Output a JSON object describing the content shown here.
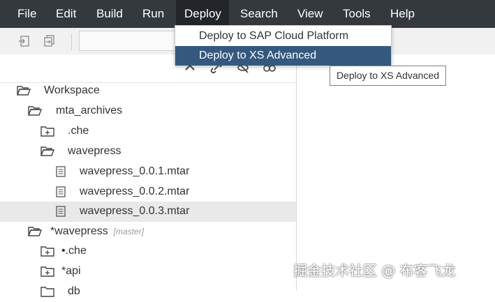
{
  "menubar": {
    "items": [
      "File",
      "Edit",
      "Build",
      "Run",
      "Deploy",
      "Search",
      "View",
      "Tools",
      "Help"
    ],
    "active": "Deploy"
  },
  "deploy_menu": {
    "items": [
      "Deploy to SAP Cloud Platform",
      "Deploy to XS Advanced"
    ],
    "highlighted": "Deploy to XS Advanced"
  },
  "tooltip": {
    "text": "Deploy to XS Advanced"
  },
  "tree": {
    "workspace": "Workspace",
    "mta_archives": "mta_archives",
    "che1": ".che",
    "wavepress_folder": "wavepress",
    "file1": "wavepress_0.0.1.mtar",
    "file2": "wavepress_0.0.2.mtar",
    "file3": "wavepress_0.0.3.mtar",
    "project_star": "*",
    "project": "wavepress",
    "project_branch": "[master]",
    "che2": "•.che",
    "api_star": "*",
    "api": "api",
    "db": "db"
  },
  "watermark": "掘金技术社区 @ 布客飞龙",
  "colors": {
    "menubar_bg": "#34393e",
    "menu_highlight": "#35597e",
    "selected_row": "#e9e9e9"
  },
  "icons": {
    "folder_open": "folder-open-icon",
    "folder_closed": "folder-closed-icon",
    "file": "file-icon"
  }
}
